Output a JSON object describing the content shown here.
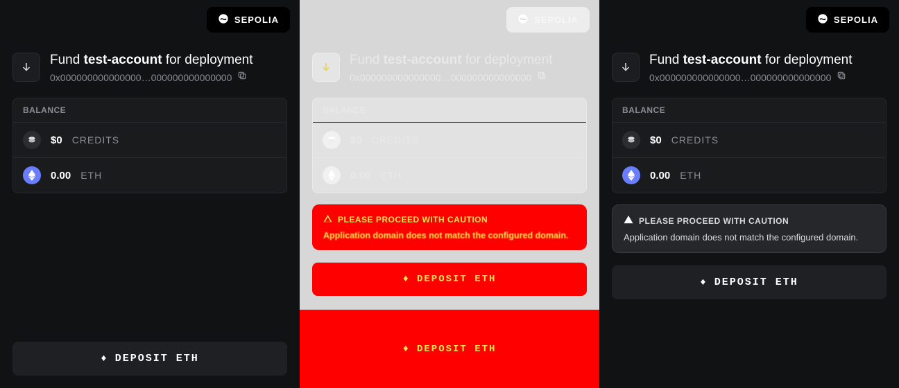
{
  "network": {
    "label": "SEPOLIA"
  },
  "fund": {
    "prefix": "Fund ",
    "account": "test-account",
    "suffix": " for deployment",
    "address": "0x000000000000000…000000000000000"
  },
  "balance": {
    "header": "BALANCE",
    "credits": {
      "value": "$0",
      "unit": "CREDITS"
    },
    "eth": {
      "value": "0.00",
      "unit": "ETH"
    }
  },
  "warning": {
    "title": "PLEASE PROCEED WITH CAUTION",
    "message": "Application domain does not match the configured domain."
  },
  "deposit": {
    "label": "DEPOSIT ETH"
  },
  "glitch": {
    "warning_title": "PLEASE PROCEED WITH CAUTION",
    "warning_message": "Application domain does not match the configured domain.",
    "deposit": "DEPOSIT ETH"
  }
}
